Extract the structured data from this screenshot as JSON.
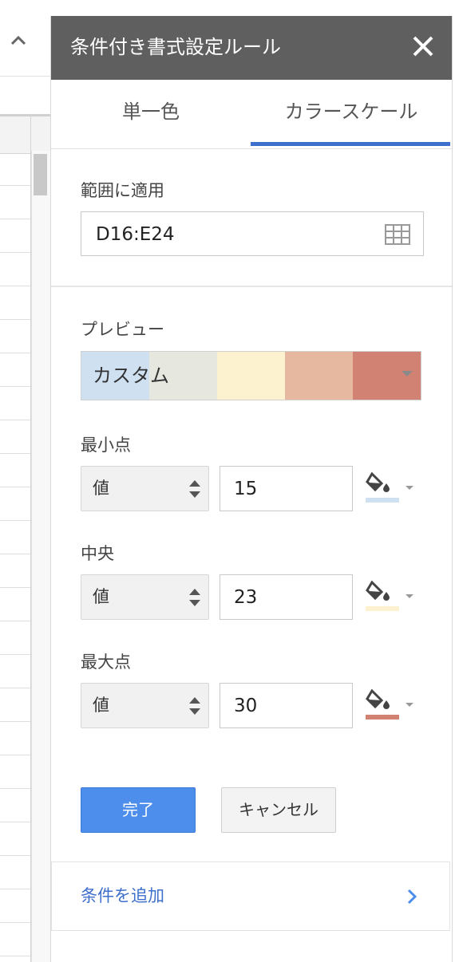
{
  "panel": {
    "title": "条件付き書式設定ルール",
    "close_icon": "close-icon"
  },
  "tabs": [
    {
      "label": "単一色",
      "active": false
    },
    {
      "label": "カラースケール",
      "active": true
    }
  ],
  "range": {
    "label": "範囲に適用",
    "value": "D16:E24",
    "icon": "grid-select-icon"
  },
  "preview": {
    "label": "プレビュー",
    "selected": "カスタム",
    "colors": [
      "#cfe0f1",
      "#e6e8e0",
      "#fcf2cf",
      "#e6b8a0",
      "#d28272"
    ]
  },
  "points": [
    {
      "label": "最小点",
      "type": "値",
      "value": "15",
      "color": "#cfe0f1"
    },
    {
      "label": "中央",
      "type": "値",
      "value": "23",
      "color": "#fcf2cf"
    },
    {
      "label": "最大点",
      "type": "値",
      "value": "30",
      "color": "#d28272"
    }
  ],
  "buttons": {
    "done": "完了",
    "cancel": "キャンセル"
  },
  "add_rule": {
    "label": "条件を追加"
  },
  "colors": {
    "accent": "#3d6fcc",
    "primary_button": "#4d8eec",
    "title_bar": "#5f5f5f"
  }
}
